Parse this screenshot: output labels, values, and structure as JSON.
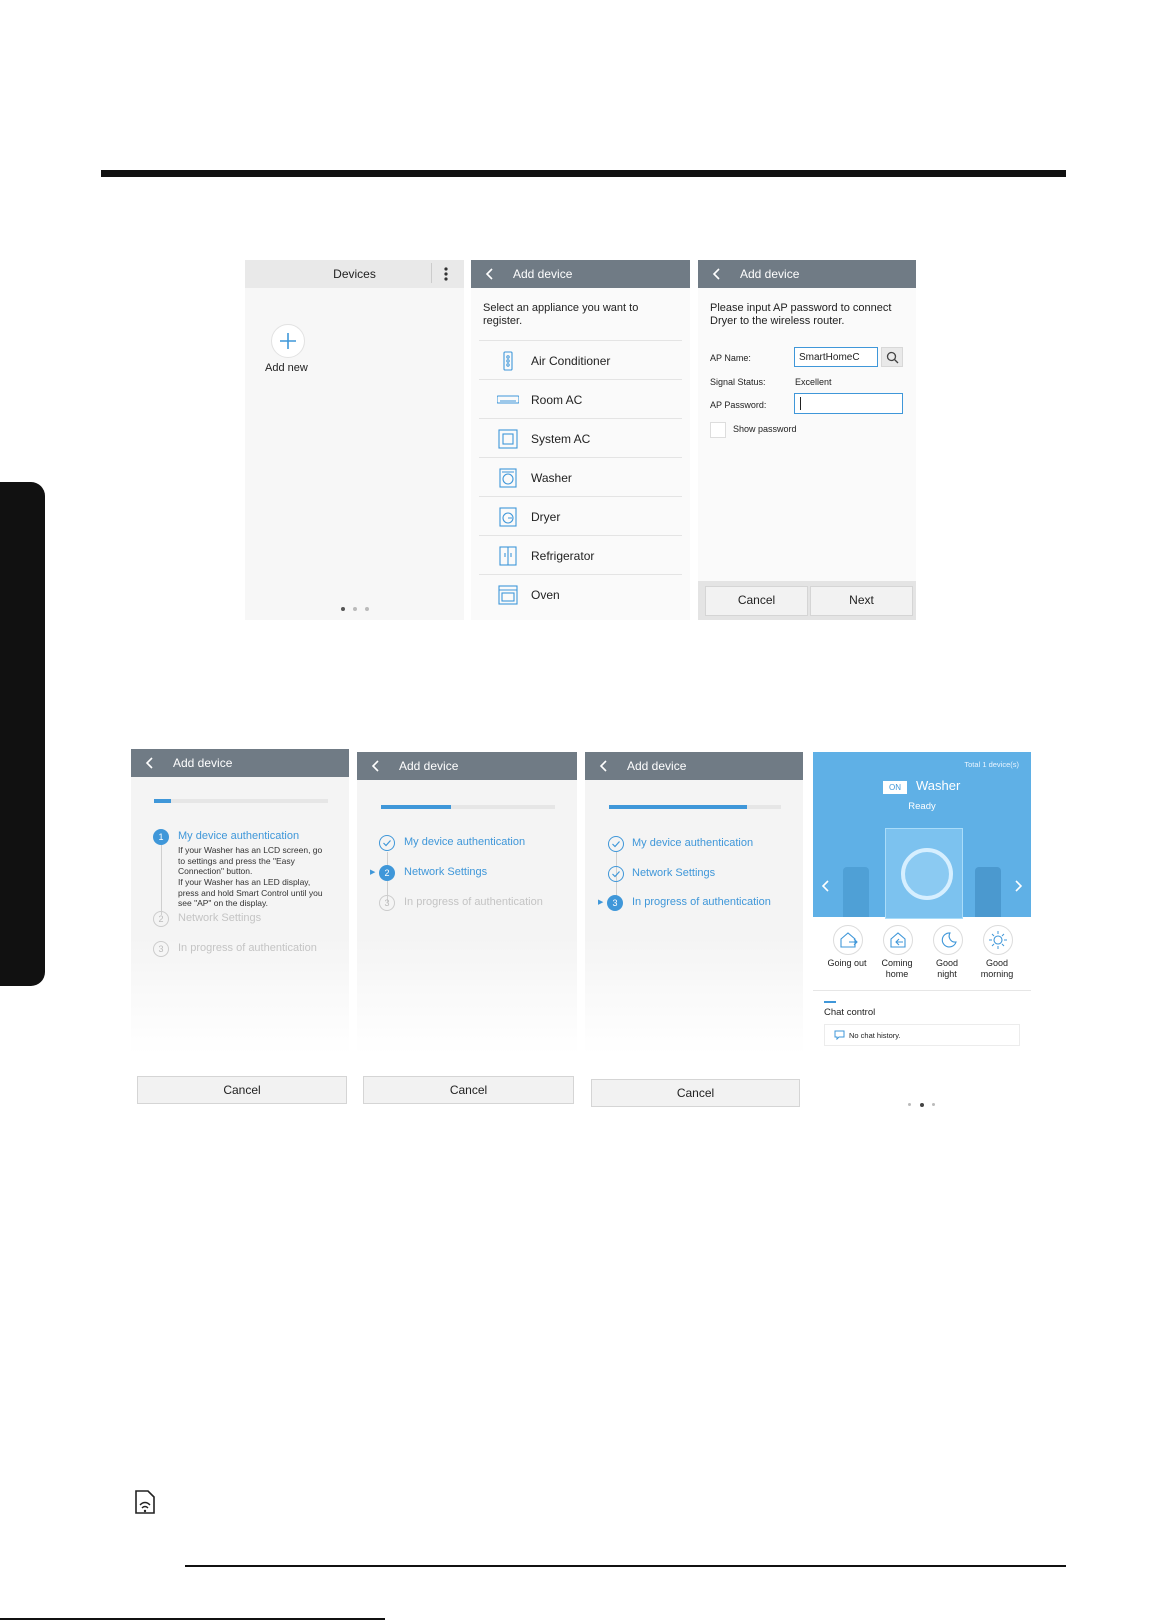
{
  "screen1": {
    "title": "Devices",
    "add_new_label": "Add new"
  },
  "screen2": {
    "title": "Add device",
    "prompt": "Select an appliance you want to register.",
    "items": [
      {
        "label": "Air Conditioner",
        "icon": "air-conditioner-icon"
      },
      {
        "label": "Room AC",
        "icon": "room-ac-icon"
      },
      {
        "label": "System AC",
        "icon": "system-ac-icon"
      },
      {
        "label": "Washer",
        "icon": "washer-icon"
      },
      {
        "label": "Dryer",
        "icon": "dryer-icon"
      },
      {
        "label": "Refrigerator",
        "icon": "refrigerator-icon"
      },
      {
        "label": "Oven",
        "icon": "oven-icon"
      }
    ]
  },
  "screen3": {
    "title": "Add device",
    "prompt": "Please input AP password to connect Dryer to the wireless router.",
    "ap_name_label": "AP Name:",
    "ap_name_value": "SmartHomeC",
    "signal_label": "Signal Status:",
    "signal_value": "Excellent",
    "password_label": "AP Password:",
    "password_value": "",
    "show_password_label": "Show password",
    "cancel_label": "Cancel",
    "next_label": "Next"
  },
  "screen4": {
    "title": "Add device",
    "progress": 0.1,
    "step1": "My device authentication",
    "step1_num": "1",
    "step1_desc1": "If your Washer has an LCD screen, go to settings and press the \"Easy Connection\" button.",
    "step1_desc2": "If your Washer has an LED display, press and hold Smart Control until you see \"AP\" on the display.",
    "step2": "Network Settings",
    "step2_num": "2",
    "step3": "In progress of authentication",
    "step3_num": "3",
    "cancel_label": "Cancel"
  },
  "screen5": {
    "title": "Add device",
    "progress": 0.4,
    "step1": "My device authentication",
    "step2": "Network Settings",
    "step2_num": "2",
    "step3": "In progress of authentication",
    "step3_num": "3",
    "cancel_label": "Cancel"
  },
  "screen6": {
    "title": "Add device",
    "progress": 0.8,
    "step1": "My device authentication",
    "step2": "Network Settings",
    "step3": "In progress of authentication",
    "step3_num": "3",
    "cancel_label": "Cancel"
  },
  "screen7": {
    "total": "Total 1 device(s)",
    "on_badge": "ON",
    "device_name": "Washer",
    "status": "Ready",
    "modes": [
      {
        "label1": "Going out",
        "label2": ""
      },
      {
        "label1": "Coming",
        "label2": "home"
      },
      {
        "label1": "Good",
        "label2": "night"
      },
      {
        "label1": "Good",
        "label2": "morning"
      }
    ],
    "chat_title": "Chat control",
    "chat_empty": "No chat history."
  },
  "colors": {
    "header": "#707b85",
    "accent": "#3f97d9",
    "hero": "#5fb0e6"
  }
}
